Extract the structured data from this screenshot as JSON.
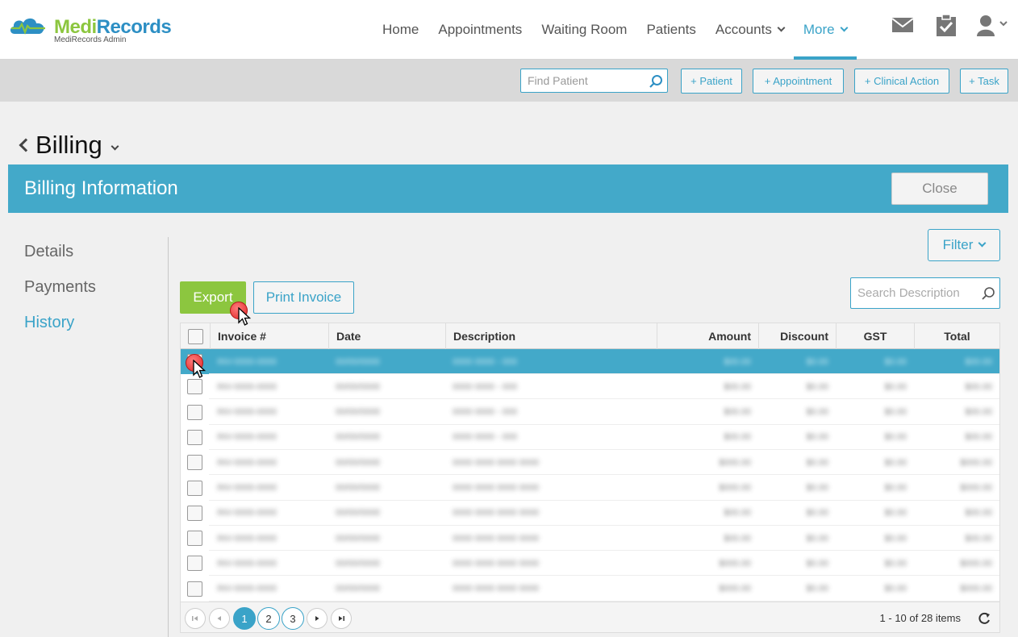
{
  "brand": {
    "name_part1": "Medi",
    "name_part2": "Records",
    "subtitle": "MediRecords Admin",
    "colors": {
      "green": "#8cc63f",
      "blue": "#2d8fc4",
      "accent": "#43a9c9"
    }
  },
  "nav": {
    "items": [
      {
        "label": "Home",
        "has_dropdown": false,
        "active": false
      },
      {
        "label": "Appointments",
        "has_dropdown": false,
        "active": false
      },
      {
        "label": "Waiting Room",
        "has_dropdown": false,
        "active": false
      },
      {
        "label": "Patients",
        "has_dropdown": false,
        "active": false
      },
      {
        "label": "Accounts",
        "has_dropdown": true,
        "active": false
      },
      {
        "label": "More",
        "has_dropdown": true,
        "active": true
      }
    ],
    "icons": [
      "mail-icon",
      "clipboard-check-icon",
      "user-icon"
    ]
  },
  "actionbar": {
    "find_patient_placeholder": "Find Patient",
    "buttons": [
      "+ Patient",
      "+ Appointment",
      "+ Clinical Action",
      "+ Task"
    ]
  },
  "page": {
    "title": "Billing"
  },
  "billing": {
    "header_title": "Billing Information",
    "close_label": "Close",
    "side_menu": [
      {
        "label": "Details",
        "active": false
      },
      {
        "label": "Payments",
        "active": false
      },
      {
        "label": "History",
        "active": true
      }
    ],
    "filter_label": "Filter",
    "export_label": "Export",
    "print_label": "Print Invoice",
    "search_placeholder": "Search Description"
  },
  "table": {
    "columns": [
      "Invoice #",
      "Date",
      "Description",
      "Amount",
      "Discount",
      "GST",
      "Total"
    ],
    "rows": [
      {
        "selected": true,
        "invoice": "INV-0000-0000",
        "date": "00/00/0000",
        "desc": "0000 0000 - 000",
        "amount": "$00.00",
        "discount": "$0.00",
        "gst": "$0.00",
        "total": "$00.00"
      },
      {
        "selected": false,
        "invoice": "INV-0000-0000",
        "date": "00/00/0000",
        "desc": "0000 0000 - 000",
        "amount": "$00.00",
        "discount": "$0.00",
        "gst": "$0.00",
        "total": "$00.00"
      },
      {
        "selected": false,
        "invoice": "INV-0000-0000",
        "date": "00/00/0000",
        "desc": "0000 0000 - 000",
        "amount": "$00.00",
        "discount": "$0.00",
        "gst": "$0.00",
        "total": "$00.00"
      },
      {
        "selected": false,
        "invoice": "INV-0000-0000",
        "date": "00/00/0000",
        "desc": "0000 0000 - 000",
        "amount": "$00.00",
        "discount": "$0.00",
        "gst": "$0.00",
        "total": "$00.00"
      },
      {
        "selected": false,
        "invoice": "INV-0000-0000",
        "date": "00/00/0000",
        "desc": "0000 0000 0000 0000",
        "amount": "$000.00",
        "discount": "$0.00",
        "gst": "$0.00",
        "total": "$000.00"
      },
      {
        "selected": false,
        "invoice": "INV-0000-0000",
        "date": "00/00/0000",
        "desc": "0000 0000 0000 0000",
        "amount": "$000.00",
        "discount": "$0.00",
        "gst": "$0.00",
        "total": "$000.00"
      },
      {
        "selected": false,
        "invoice": "INV-0000-0000",
        "date": "00/00/0000",
        "desc": "0000 0000 0000 0000",
        "amount": "$00.00",
        "discount": "$0.00",
        "gst": "$0.00",
        "total": "$00.00"
      },
      {
        "selected": false,
        "invoice": "INV-0000-0000",
        "date": "00/00/0000",
        "desc": "0000 0000 0000 0000",
        "amount": "$00.00",
        "discount": "$0.00",
        "gst": "$0.00",
        "total": "$00.00"
      },
      {
        "selected": false,
        "invoice": "INV-0000-0000",
        "date": "00/00/0000",
        "desc": "0000 0000 0000 0000",
        "amount": "$000.00",
        "discount": "$0.00",
        "gst": "$0.00",
        "total": "$000.00"
      },
      {
        "selected": false,
        "invoice": "INV-0000-0000",
        "date": "00/00/0000",
        "desc": "0000 0000 0000 0000",
        "amount": "$000.00",
        "discount": "$0.00",
        "gst": "$0.00",
        "total": "$000.00"
      }
    ]
  },
  "pager": {
    "pages": [
      "1",
      "2",
      "3"
    ],
    "current": "1",
    "info": "1 - 10 of 28 items"
  }
}
